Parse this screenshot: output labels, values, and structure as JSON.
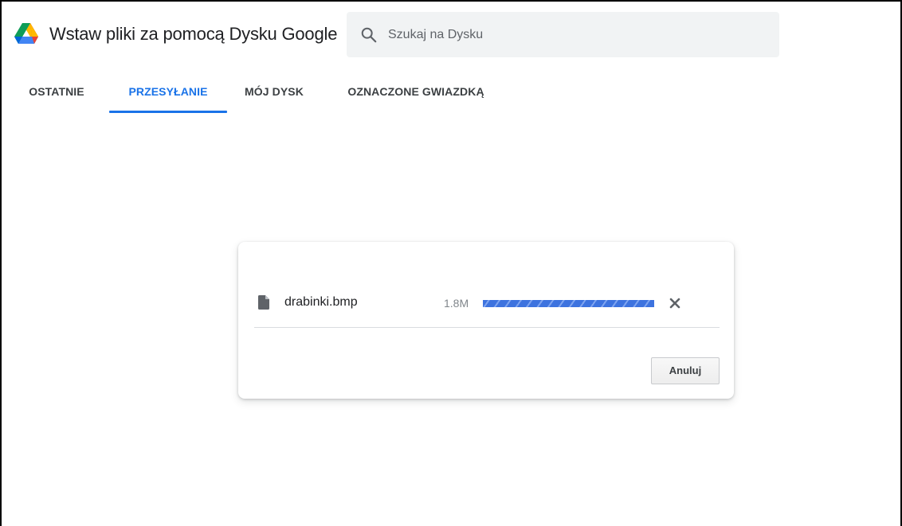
{
  "header": {
    "title": "Wstaw pliki za pomocą Dysku Google",
    "logo_icon": "google-drive-logo-icon",
    "search": {
      "placeholder": "Szukaj na Dysku",
      "value": "",
      "icon": "search-icon"
    }
  },
  "tabs": [
    {
      "label": "OSTATNIE",
      "active": false
    },
    {
      "label": "PRZESYŁANIE",
      "active": true
    },
    {
      "label": "MÓJ DYSK",
      "active": false
    },
    {
      "label": "OZNACZONE GWIAZDKĄ",
      "active": false
    }
  ],
  "upload_dialog": {
    "file": {
      "name": "drabinki.bmp",
      "size": "1.8M",
      "icon": "file-icon",
      "progress_percent": 100
    },
    "close_icon": "close-icon",
    "cancel_label": "Anuluj"
  },
  "colors": {
    "accent": "#1a73e8",
    "progress": "#4a7fe6",
    "search_bg": "#f1f3f4",
    "tab_text": "#3c4043"
  }
}
